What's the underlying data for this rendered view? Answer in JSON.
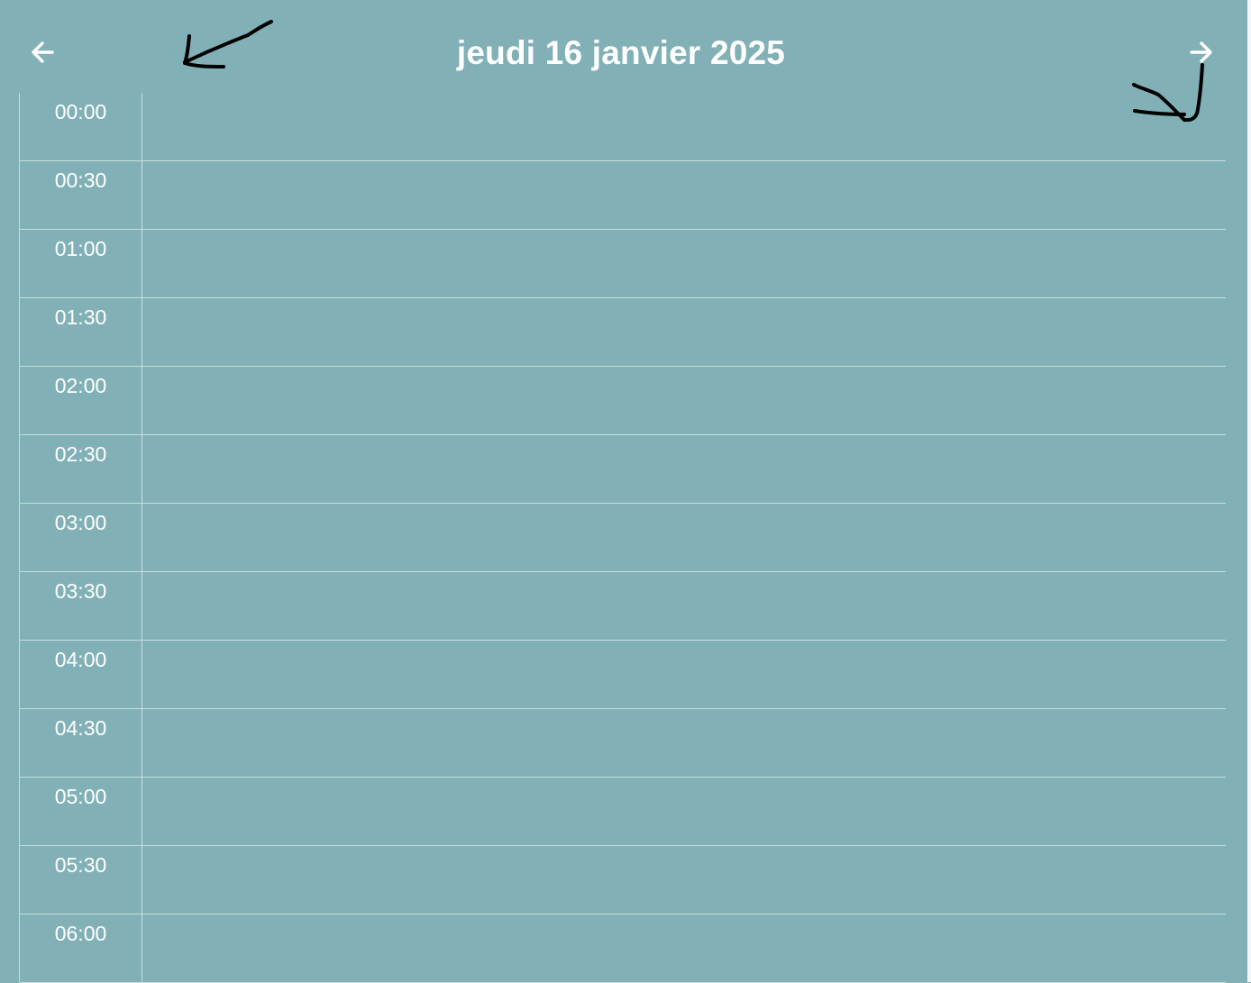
{
  "header": {
    "title": "jeudi 16 janvier 2025",
    "prev_icon": "arrow-left-icon",
    "next_icon": "arrow-right-icon"
  },
  "day_view": {
    "time_slots": [
      "00:00",
      "00:30",
      "01:00",
      "01:30",
      "02:00",
      "02:30",
      "03:00",
      "03:30",
      "04:00",
      "04:30",
      "05:00",
      "05:30",
      "06:00"
    ]
  },
  "colors": {
    "background": "#81b1b6",
    "text": "#ffffff",
    "grid_line": "#c9dcde",
    "annotation_ink": "#000000"
  }
}
